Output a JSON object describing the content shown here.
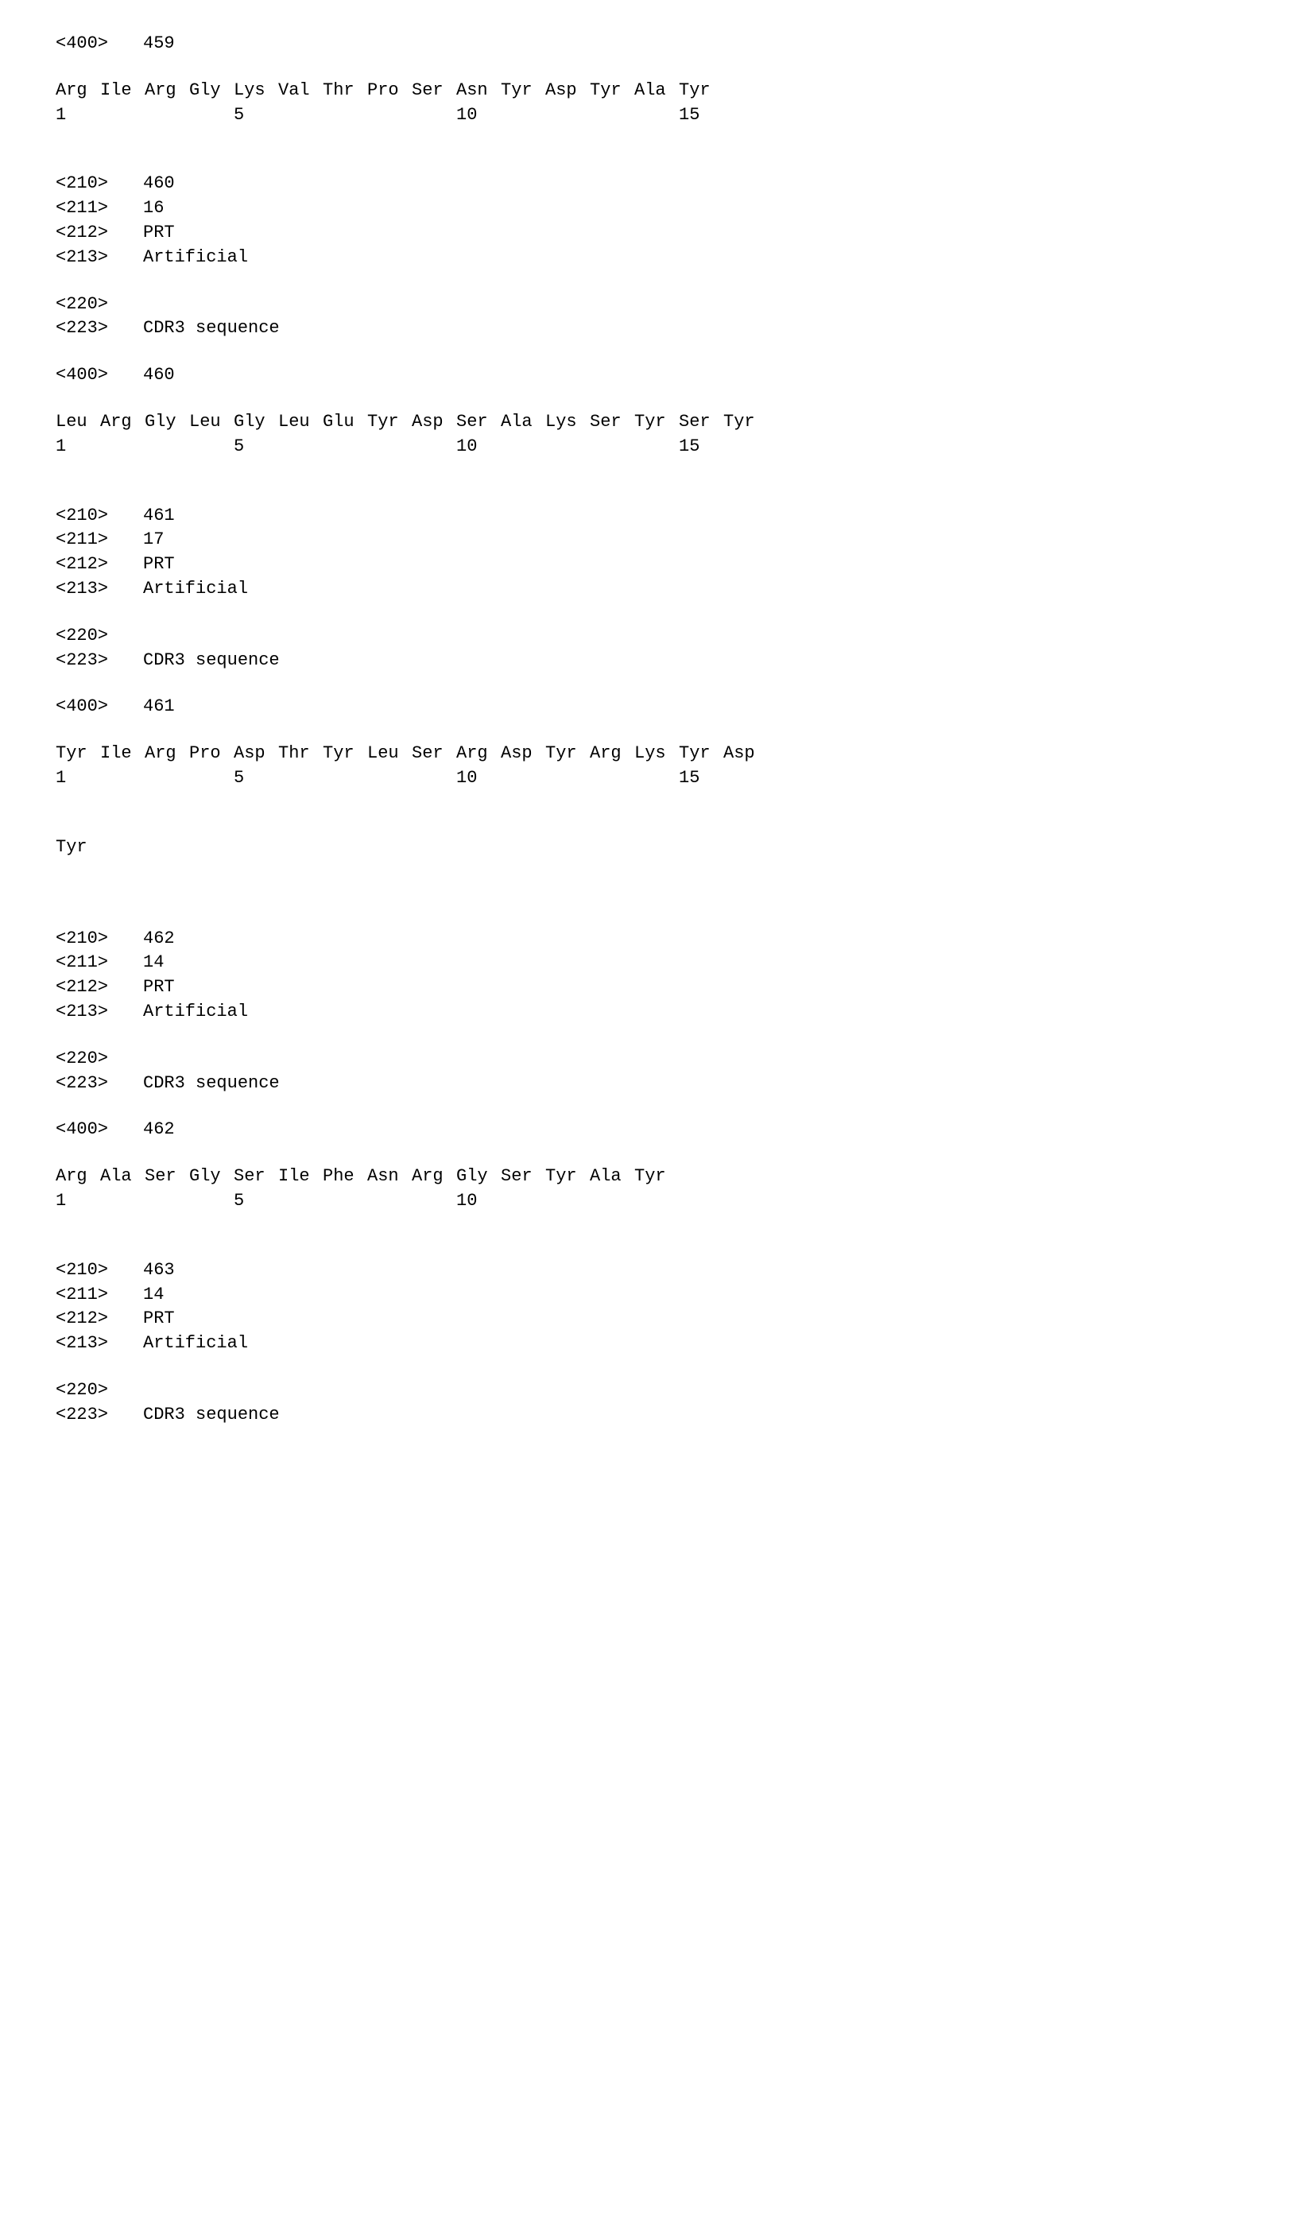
{
  "block459": {
    "tag400": {
      "key": "<400>",
      "val": "459"
    },
    "seq": [
      "Arg",
      "Ile",
      "Arg",
      "Gly",
      "Lys",
      "Val",
      "Thr",
      "Pro",
      "Ser",
      "Asn",
      "Tyr",
      "Asp",
      "Tyr",
      "Ala",
      "Tyr"
    ],
    "nums": [
      "1",
      "",
      "",
      "",
      "5",
      "",
      "",
      "",
      "",
      "10",
      "",
      "",
      "",
      "",
      "15"
    ]
  },
  "block460": {
    "tag210": {
      "key": "<210>",
      "val": "460"
    },
    "tag211": {
      "key": "<211>",
      "val": "16"
    },
    "tag212": {
      "key": "<212>",
      "val": "PRT"
    },
    "tag213": {
      "key": "<213>",
      "val": "Artificial"
    },
    "tag220": {
      "key": "<220>",
      "val": ""
    },
    "tag223": {
      "key": "<223>",
      "val": "CDR3 sequence"
    },
    "tag400": {
      "key": "<400>",
      "val": "460"
    },
    "seq": [
      "Leu",
      "Arg",
      "Gly",
      "Leu",
      "Gly",
      "Leu",
      "Glu",
      "Tyr",
      "Asp",
      "Ser",
      "Ala",
      "Lys",
      "Ser",
      "Tyr",
      "Ser",
      "Tyr"
    ],
    "nums": [
      "1",
      "",
      "",
      "",
      "5",
      "",
      "",
      "",
      "",
      "10",
      "",
      "",
      "",
      "",
      "15",
      ""
    ]
  },
  "block461": {
    "tag210": {
      "key": "<210>",
      "val": "461"
    },
    "tag211": {
      "key": "<211>",
      "val": "17"
    },
    "tag212": {
      "key": "<212>",
      "val": "PRT"
    },
    "tag213": {
      "key": "<213>",
      "val": "Artificial"
    },
    "tag220": {
      "key": "<220>",
      "val": ""
    },
    "tag223": {
      "key": "<223>",
      "val": "CDR3 sequence"
    },
    "tag400": {
      "key": "<400>",
      "val": "461"
    },
    "seq1": [
      "Tyr",
      "Ile",
      "Arg",
      "Pro",
      "Asp",
      "Thr",
      "Tyr",
      "Leu",
      "Ser",
      "Arg",
      "Asp",
      "Tyr",
      "Arg",
      "Lys",
      "Tyr",
      "Asp"
    ],
    "nums": [
      "1",
      "",
      "",
      "",
      "5",
      "",
      "",
      "",
      "",
      "10",
      "",
      "",
      "",
      "",
      "15",
      ""
    ],
    "seq2": [
      "Tyr"
    ]
  },
  "block462": {
    "tag210": {
      "key": "<210>",
      "val": "462"
    },
    "tag211": {
      "key": "<211>",
      "val": "14"
    },
    "tag212": {
      "key": "<212>",
      "val": "PRT"
    },
    "tag213": {
      "key": "<213>",
      "val": "Artificial"
    },
    "tag220": {
      "key": "<220>",
      "val": ""
    },
    "tag223": {
      "key": "<223>",
      "val": "CDR3 sequence"
    },
    "tag400": {
      "key": "<400>",
      "val": "462"
    },
    "seq": [
      "Arg",
      "Ala",
      "Ser",
      "Gly",
      "Ser",
      "Ile",
      "Phe",
      "Asn",
      "Arg",
      "Gly",
      "Ser",
      "Tyr",
      "Ala",
      "Tyr"
    ],
    "nums": [
      "1",
      "",
      "",
      "",
      "5",
      "",
      "",
      "",
      "",
      "10",
      "",
      "",
      "",
      ""
    ]
  },
  "block463": {
    "tag210": {
      "key": "<210>",
      "val": "463"
    },
    "tag211": {
      "key": "<211>",
      "val": "14"
    },
    "tag212": {
      "key": "<212>",
      "val": "PRT"
    },
    "tag213": {
      "key": "<213>",
      "val": "Artificial"
    },
    "tag220": {
      "key": "<220>",
      "val": ""
    },
    "tag223": {
      "key": "<223>",
      "val": "CDR3 sequence"
    }
  }
}
